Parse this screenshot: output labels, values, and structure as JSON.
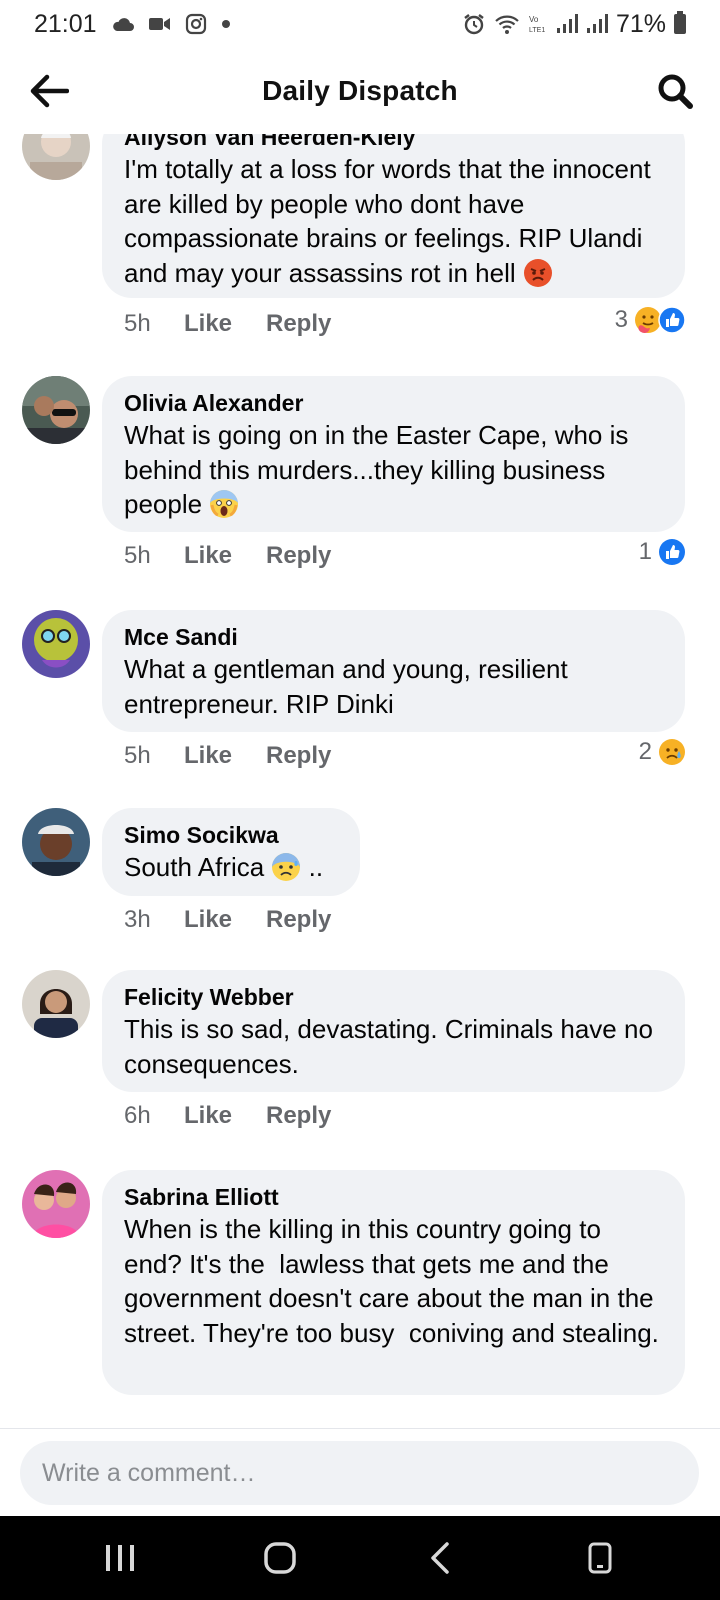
{
  "status_bar": {
    "time": "21:01",
    "battery": "71%"
  },
  "header": {
    "title": "Daily Dispatch"
  },
  "comments": [
    {
      "author": "Allyson Van Heerden-Kiely",
      "text": "I'm totally at a loss for words that the innocent are killed by people who dont have compassionate brains or feelings. RIP Ulandi and may your assassins rot in hell",
      "emoji": "angry-face-icon",
      "time": "5h",
      "like": "Like",
      "reply": "Reply",
      "reaction_count": "3",
      "reactions": [
        "care-reaction-icon",
        "like-reaction-icon"
      ]
    },
    {
      "author": "Olivia Alexander",
      "text": "What is going on in the Easter Cape, who is behind this murders...they killing business people",
      "emoji": "screaming-face-icon",
      "time": "5h",
      "like": "Like",
      "reply": "Reply",
      "reaction_count": "1",
      "reactions": [
        "like-reaction-icon"
      ]
    },
    {
      "author": "Mce Sandi",
      "text": "What a gentleman and young, resilient entrepreneur. RIP Dinki",
      "time": "5h",
      "like": "Like",
      "reply": "Reply",
      "reaction_count": "2",
      "reactions": [
        "sad-reaction-icon"
      ]
    },
    {
      "author": "Simo Socikwa",
      "text": "South Africa",
      "text_after": "..",
      "emoji": "anxious-face-icon",
      "time": "3h",
      "like": "Like",
      "reply": "Reply"
    },
    {
      "author": "Felicity Webber",
      "text": "This is so sad, devastating. Criminals have no consequences.",
      "time": "6h",
      "like": "Like",
      "reply": "Reply"
    },
    {
      "author": "Sabrina Elliott",
      "text": "When is the killing in this country going to end? It's the  lawless that gets me and the government doesn't care about the man in the street. They're too busy  coniving and stealing."
    }
  ],
  "composer": {
    "placeholder": "Write a comment…"
  },
  "colors": {
    "bubble": "#f0f2f5",
    "secondary_text": "#65676b",
    "like_blue": "#1877f2",
    "nav_bar": "#000000"
  }
}
